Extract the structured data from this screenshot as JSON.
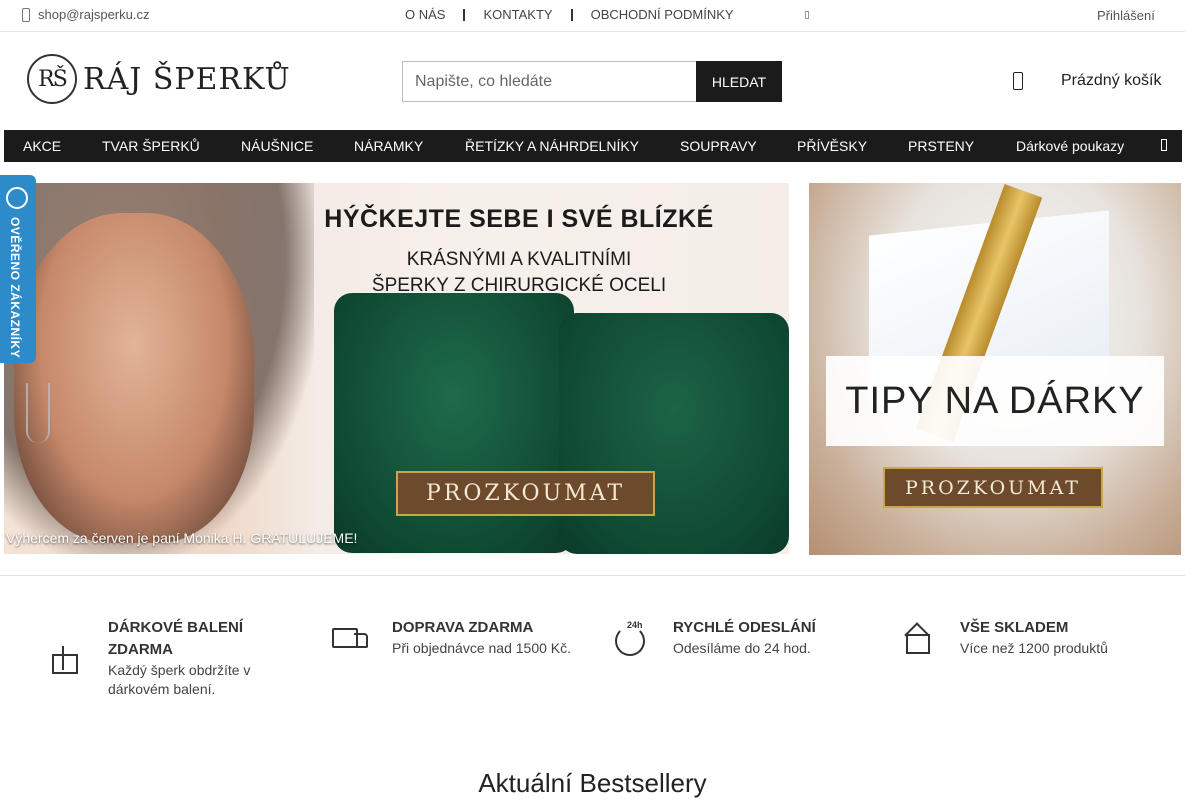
{
  "topbar": {
    "email": "shop@rajsperku.cz",
    "links": [
      "O NÁS",
      "KONTAKTY",
      "OBCHODNÍ PODMÍNKY"
    ],
    "login": "Přihlášení"
  },
  "header": {
    "logo_mark": "RŠ",
    "logo_text": "RÁJ ŠPERKŮ",
    "search_placeholder": "Napište, co hledáte",
    "search_button": "HLEDAT",
    "cart_label": "Prázdný košík"
  },
  "nav": {
    "items": [
      "AKCE",
      "TVAR ŠPERKŮ",
      "NÁUŠNICE",
      "NÁRAMKY",
      "ŘETÍZKY A NÁHRDELNÍKY",
      "SOUPRAVY",
      "PŘÍVĚSKY",
      "PRSTENY",
      "Dárkové poukazy"
    ]
  },
  "badge": {
    "text": "OVĚŘENO ZÁKAZNÍKY"
  },
  "banner_left": {
    "headline": "HÝČKEJTE SEBE I SVÉ BLÍZKÉ",
    "subline_1": "KRÁSNÝMI A KVALITNÍMI",
    "subline_2": "ŠPERKY Z CHIRURGICKÉ OCELI",
    "cta": "PROZKOUMAT",
    "winner": "Výhercem za červen je paní Monika H. GRATULUJEME!"
  },
  "banner_right": {
    "title": "TIPY NA DÁRKY",
    "cta": "PROZKOUMAT"
  },
  "features": [
    {
      "icon": "gift-icon",
      "title": "DÁRKOVÉ BALENÍ ZDARMA",
      "desc": "Každý šperk obdržíte v dárkovém balení."
    },
    {
      "icon": "truck-icon",
      "title": "DOPRAVA ZDARMA",
      "desc": "Při objednávce nad 1500 Kč."
    },
    {
      "icon": "clock-24h-icon",
      "title": "RYCHLÉ ODESLÁNÍ",
      "desc": "Odesíláme do 24 hod."
    },
    {
      "icon": "house-icon",
      "title": "VŠE SKLADEM",
      "desc": "Více než 1200 produktů"
    }
  ],
  "section_title": "Aktuální Bestsellery",
  "colors": {
    "nav_bg": "#1b1b1b",
    "badge_bg": "#2e8bc9",
    "cta_bg": "#6e4a2c",
    "cta_border": "#c9a64a"
  }
}
